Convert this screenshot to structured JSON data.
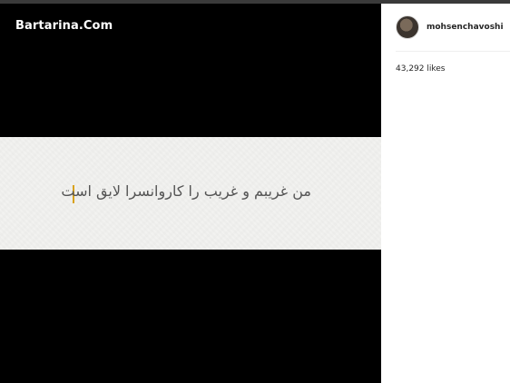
{
  "watermark": {
    "text": "Bartarina.Com"
  },
  "post": {
    "caption_text": "من غریبم و غریب را کاروانسرا لایق است",
    "accent_color": "#d9a21b"
  },
  "sidebar": {
    "username": "mohsenchavoshi",
    "likes_text": "43,292 likes",
    "avatar_icon": "avatar-photo-icon"
  }
}
